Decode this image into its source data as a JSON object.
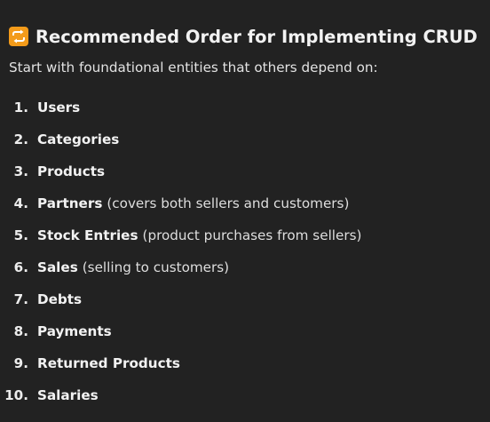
{
  "header": {
    "icon": "repeat-arrows-icon",
    "icon_color": "#f39b1a",
    "title": "Recommended Order for Implementing CRUD"
  },
  "intro": "Start with foundational entities that others depend on:",
  "items": [
    {
      "number": "1.",
      "title": "Users",
      "note": ""
    },
    {
      "number": "2.",
      "title": "Categories",
      "note": ""
    },
    {
      "number": "3.",
      "title": "Products",
      "note": ""
    },
    {
      "number": "4.",
      "title": "Partners",
      "note": "(covers both sellers and customers)"
    },
    {
      "number": "5.",
      "title": "Stock Entries",
      "note": "(product purchases from sellers)"
    },
    {
      "number": "6.",
      "title": "Sales",
      "note": "(selling to customers)"
    },
    {
      "number": "7.",
      "title": "Debts",
      "note": ""
    },
    {
      "number": "8.",
      "title": "Payments",
      "note": ""
    },
    {
      "number": "9.",
      "title": "Returned Products",
      "note": ""
    },
    {
      "number": "10.",
      "title": "Salaries",
      "note": ""
    }
  ]
}
